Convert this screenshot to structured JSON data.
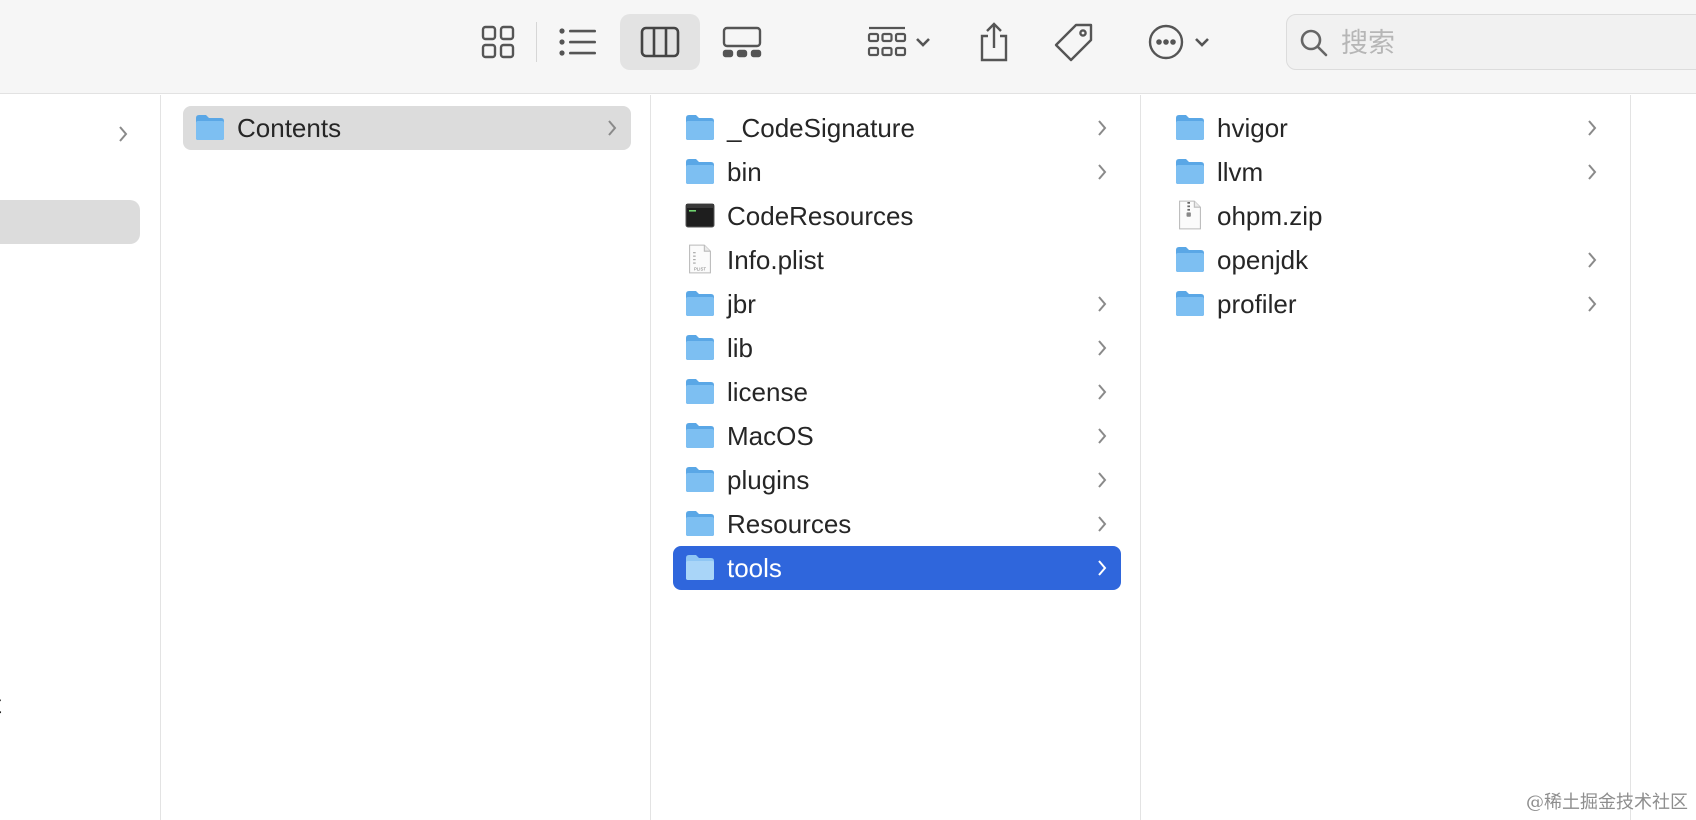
{
  "search": {
    "placeholder": "搜索",
    "value": ""
  },
  "toolbar": {
    "icons": [
      "icon-view-icon",
      "list-view-icon",
      "column-view-icon",
      "gallery-view-icon",
      "group-icon",
      "share-icon",
      "tag-icon",
      "more-actions-icon"
    ],
    "active_view": "column-view"
  },
  "sidebar": {
    "truncated_label": "t"
  },
  "columns": [
    {
      "items": [
        {
          "name": "Contents",
          "kind": "folder",
          "has_children": true,
          "state": "parent-selected"
        }
      ]
    },
    {
      "items": [
        {
          "name": "_CodeSignature",
          "kind": "folder",
          "has_children": true
        },
        {
          "name": "bin",
          "kind": "folder",
          "has_children": true
        },
        {
          "name": "CodeResources",
          "kind": "exec",
          "has_children": false
        },
        {
          "name": "Info.plist",
          "kind": "plist",
          "has_children": false
        },
        {
          "name": "jbr",
          "kind": "folder",
          "has_children": true
        },
        {
          "name": "lib",
          "kind": "folder",
          "has_children": true
        },
        {
          "name": "license",
          "kind": "folder",
          "has_children": true
        },
        {
          "name": "MacOS",
          "kind": "folder",
          "has_children": true
        },
        {
          "name": "plugins",
          "kind": "folder",
          "has_children": true
        },
        {
          "name": "Resources",
          "kind": "folder",
          "has_children": true
        },
        {
          "name": "tools",
          "kind": "folder",
          "has_children": true,
          "state": "selected"
        }
      ]
    },
    {
      "items": [
        {
          "name": "hvigor",
          "kind": "folder",
          "has_children": true
        },
        {
          "name": "llvm",
          "kind": "folder",
          "has_children": true
        },
        {
          "name": "ohpm.zip",
          "kind": "zip",
          "has_children": false
        },
        {
          "name": "openjdk",
          "kind": "folder",
          "has_children": true
        },
        {
          "name": "profiler",
          "kind": "folder",
          "has_children": true
        }
      ]
    }
  ],
  "colors": {
    "selection": "#2f66dc",
    "parent_selection": "#dcdcdc",
    "folder": "#6fb6ee"
  },
  "watermark": "@稀土掘金技术社区"
}
